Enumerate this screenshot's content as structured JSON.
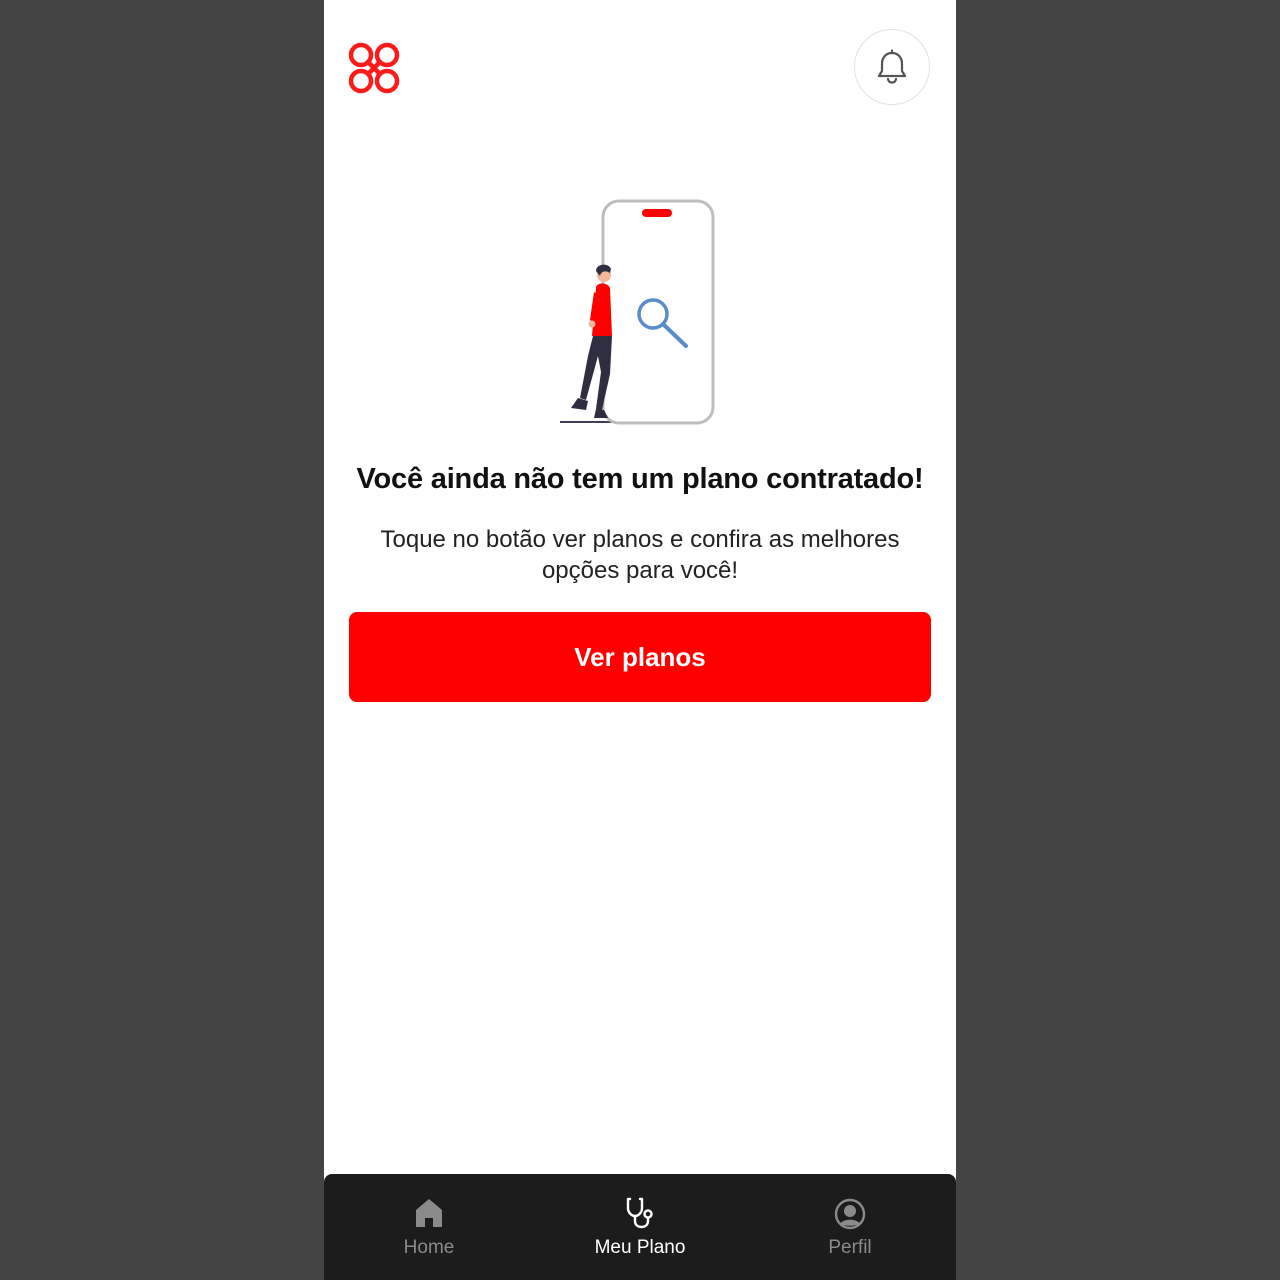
{
  "header": {
    "logo_icon": "infinity-cross-logo",
    "notifications_icon": "bell-icon"
  },
  "empty_state": {
    "illustration": "person-with-phone-search-illustration",
    "title": "Você ainda não tem um plano contratado!",
    "subtitle": "Toque no botão ver planos e confira as melhores opções para você!",
    "button_label": "Ver planos"
  },
  "bottom_nav": {
    "items": [
      {
        "label": "Home",
        "icon": "home-icon",
        "active": false
      },
      {
        "label": "Meu Plano",
        "icon": "stethoscope-icon",
        "active": true
      },
      {
        "label": "Perfil",
        "icon": "user-circle-icon",
        "active": false
      }
    ]
  },
  "colors": {
    "accent": "#ff0000",
    "background": "#ffffff",
    "nav_background": "#1c1c1c",
    "nav_active": "#ffffff",
    "nav_inactive": "#8a8a8a",
    "outer_background": "#444444"
  }
}
